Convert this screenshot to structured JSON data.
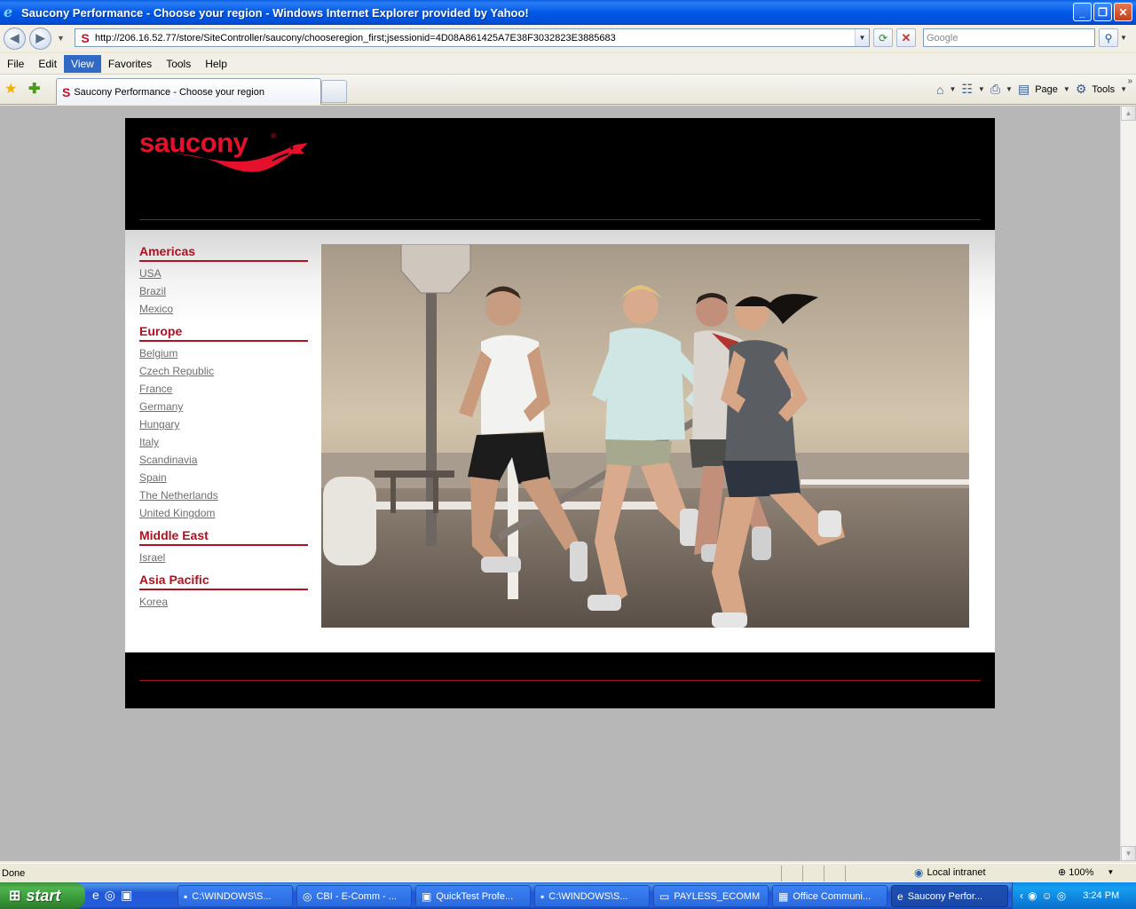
{
  "window": {
    "title": "Saucony Performance - Choose your region - Windows Internet Explorer provided by Yahoo!"
  },
  "browser": {
    "url": "http://206.16.52.77/store/SiteController/saucony/chooseregion_first;jsessionid=4D08A861425A7E38F3032823E3885683",
    "search_placeholder": "Google",
    "menu": [
      "File",
      "Edit",
      "View",
      "Favorites",
      "Tools",
      "Help"
    ],
    "active_menu": "View",
    "tab_label": "Saucony Performance - Choose your region",
    "cmd_page": "Page",
    "cmd_tools": "Tools"
  },
  "site": {
    "logo_text": "saucony",
    "logo_mark": "®",
    "regions": [
      {
        "name": "Americas",
        "countries": [
          "USA",
          "Brazil",
          "Mexico"
        ]
      },
      {
        "name": "Europe",
        "countries": [
          "Belgium",
          "Czech Republic",
          "France",
          "Germany",
          "Hungary",
          "Italy",
          "Scandinavia",
          "Spain",
          "The Netherlands",
          "United Kingdom"
        ]
      },
      {
        "name": "Middle East",
        "countries": [
          "Israel"
        ]
      },
      {
        "name": "Asia Pacific",
        "countries": [
          "Korea"
        ]
      }
    ],
    "accent_color": "#b01020"
  },
  "status": {
    "text": "Done",
    "zone": "Local intranet",
    "zoom": "100%"
  },
  "taskbar": {
    "start_label": "start",
    "buttons": [
      "C:\\WINDOWS\\S...",
      "CBI - E-Comm - ...",
      "QuickTest Profe...",
      "C:\\WINDOWS\\S...",
      "PAYLESS_ECOMM",
      "Office Communi...",
      "Saucony Perfor..."
    ],
    "active_index": 6,
    "clock": "3:24 PM"
  }
}
